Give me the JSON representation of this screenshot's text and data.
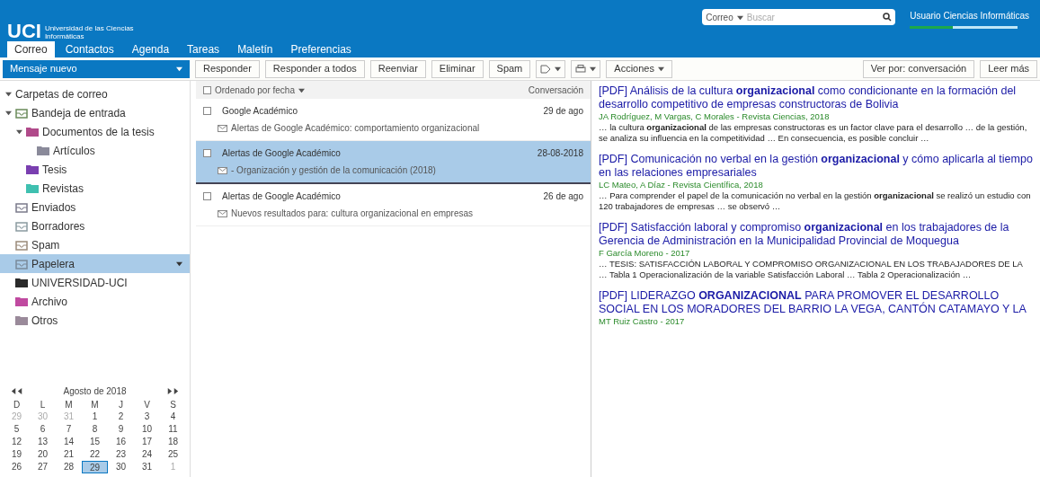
{
  "header": {
    "logo": "UCI",
    "logo_subtitle": "Universidad de las Ciencias Informáticas",
    "search": {
      "scope": "Correo",
      "placeholder": "Buscar"
    },
    "user": {
      "name": "Usuario Ciencias Informáticas",
      "quota": {
        "level": 0.4
      }
    }
  },
  "tabs": [
    {
      "label": "Correo",
      "selected": true
    },
    {
      "label": "Contactos",
      "selected": false
    },
    {
      "label": "Agenda",
      "selected": false
    },
    {
      "label": "Tareas",
      "selected": false
    },
    {
      "label": "Maletín",
      "selected": false
    },
    {
      "label": "Preferencias",
      "selected": false
    }
  ],
  "toolbar": {
    "new_button": "Mensaje nuevo",
    "buttons": [
      "Responder",
      "Responder a todos",
      "Reenviar",
      "Eliminar",
      "Spam"
    ],
    "actions": "Acciones",
    "right": [
      "Ver por: conversación",
      "Leer más"
    ]
  },
  "sidebar": {
    "heading": "Carpetas de correo",
    "folders": [
      {
        "label": "Bandeja de entrada",
        "kind": "inbox",
        "selected": false,
        "expanded": true,
        "children": [
          {
            "label": "Documentos de la tesis",
            "kind": "folder",
            "color": "#b04a8a",
            "selected": false,
            "expanded": true,
            "children": [
              {
                "label": "Artículos",
                "kind": "folder",
                "color": "#8a8a9a",
                "selected": false
              }
            ]
          },
          {
            "label": "Tesis",
            "kind": "folder",
            "color": "#7a3fb0",
            "selected": false
          },
          {
            "label": "Revistas",
            "kind": "folder",
            "color": "#3fc0b0",
            "selected": false
          }
        ]
      },
      {
        "label": "Enviados",
        "kind": "sent",
        "selected": false
      },
      {
        "label": "Borradores",
        "kind": "drafts",
        "selected": false
      },
      {
        "label": "Spam",
        "kind": "spam",
        "selected": false
      },
      {
        "label": "Papelera",
        "kind": "trash",
        "selected": true
      },
      {
        "label": "UNIVERSIDAD-UCI",
        "kind": "folder",
        "color": "#2a2a2a",
        "selected": false
      },
      {
        "label": "Archivo",
        "kind": "folder",
        "color": "#c04aa0",
        "selected": false
      },
      {
        "label": "Otros",
        "kind": "folder",
        "color": "#9a8a9a",
        "selected": false
      }
    ]
  },
  "calendar": {
    "month": "Agosto de 2018",
    "weekdays": [
      "D",
      "L",
      "M",
      "M",
      "J",
      "V",
      "S"
    ],
    "weeks": [
      [
        {
          "day": "29",
          "other": true,
          "selected": false
        },
        {
          "day": "30",
          "other": true,
          "selected": false
        },
        {
          "day": "31",
          "other": true,
          "selected": false
        },
        {
          "day": "1",
          "other": false,
          "selected": false
        },
        {
          "day": "2",
          "other": false,
          "selected": false
        },
        {
          "day": "3",
          "other": false,
          "selected": false
        },
        {
          "day": "4",
          "other": false,
          "selected": false
        }
      ],
      [
        {
          "day": "5",
          "other": false,
          "selected": false
        },
        {
          "day": "6",
          "other": false,
          "selected": false
        },
        {
          "day": "7",
          "other": false,
          "selected": false
        },
        {
          "day": "8",
          "other": false,
          "selected": false
        },
        {
          "day": "9",
          "other": false,
          "selected": false
        },
        {
          "day": "10",
          "other": false,
          "selected": false
        },
        {
          "day": "11",
          "other": false,
          "selected": false
        }
      ],
      [
        {
          "day": "12",
          "other": false,
          "selected": false
        },
        {
          "day": "13",
          "other": false,
          "selected": false
        },
        {
          "day": "14",
          "other": false,
          "selected": false
        },
        {
          "day": "15",
          "other": false,
          "selected": false
        },
        {
          "day": "16",
          "other": false,
          "selected": false
        },
        {
          "day": "17",
          "other": false,
          "selected": false
        },
        {
          "day": "18",
          "other": false,
          "selected": false
        }
      ],
      [
        {
          "day": "19",
          "other": false,
          "selected": false
        },
        {
          "day": "20",
          "other": false,
          "selected": false
        },
        {
          "day": "21",
          "other": false,
          "selected": false
        },
        {
          "day": "22",
          "other": false,
          "selected": false
        },
        {
          "day": "23",
          "other": false,
          "selected": false
        },
        {
          "day": "24",
          "other": false,
          "selected": false
        },
        {
          "day": "25",
          "other": false,
          "selected": false
        }
      ],
      [
        {
          "day": "26",
          "other": false,
          "selected": false
        },
        {
          "day": "27",
          "other": false,
          "selected": false
        },
        {
          "day": "28",
          "other": false,
          "selected": false
        },
        {
          "day": "29",
          "other": false,
          "selected": true
        },
        {
          "day": "30",
          "other": false,
          "selected": false
        },
        {
          "day": "31",
          "other": false,
          "selected": false
        },
        {
          "day": "1",
          "other": true,
          "selected": false
        }
      ]
    ]
  },
  "message_list": {
    "sort_label": "Ordenado por fecha",
    "count_label": "Conversación",
    "messages": [
      {
        "sender": "Google Académico",
        "date": "29 de ago",
        "subject": "Alertas de Google Académico: comportamiento organizacional",
        "selected": false,
        "checked": false
      },
      {
        "sender": "Alertas de Google Académico",
        "date": "28-08-2018",
        "subject": "- Organización y gestión de la comunicación (2018)",
        "selected": true,
        "checked": false
      },
      {
        "sender": "Alertas de Google Académico",
        "date": "26 de ago",
        "subject": "Nuevos resultados para: cultura organizacional en empresas",
        "selected": false,
        "checked": false
      }
    ],
    "all_checked": false
  },
  "preview": {
    "results": [
      {
        "title": "[PDF] Análisis de la cultura **organizacional** como condicionante en la formación del desarrollo competitivo de empresas constructoras de Bolivia",
        "meta": "JA Rodríguez, M Vargas, C Morales - Revista Ciencias, 2018",
        "snippet": "… la cultura **organizacional** de las empresas constructoras es un factor clave para el desarrollo … de la gestión, se analiza su influencia en la competitividad … En consecuencia, es posible concluir …"
      },
      {
        "title": "[PDF] Comunicación no verbal en la gestión **organizacional** y cómo aplicarla al tiempo en las relaciones empresariales",
        "meta": "LC Mateo, A Díaz - Revista Científica, 2018",
        "snippet": "… Para comprender el papel de la comunicación no verbal en la gestión **organizacional** se realizó un estudio con 120 trabajadores de empresas … se observó …"
      },
      {
        "title": "[PDF] Satisfacción laboral y compromiso **organizacional** en los trabajadores de la Gerencia de Administración en la Municipalidad Provincial de Moquegua",
        "meta": "F García Moreno - 2017",
        "snippet": "… TESIS: SATISFACCIÓN LABORAL Y COMPROMISO ORGANIZACIONAL EN LOS TRABAJADORES DE LA … Tabla 1 Operacionalización de la variable Satisfacción Laboral … Tabla 2 Operacionalización …"
      },
      {
        "title": "[PDF] LIDERAZGO **ORGANIZACIONAL** PARA PROMOVER EL DESARROLLO SOCIAL EN LOS MORADORES DEL BARRIO LA VEGA, CANTÓN CATAMAYO Y LA",
        "meta": "MT Ruiz Castro - 2017"
      }
    ]
  }
}
